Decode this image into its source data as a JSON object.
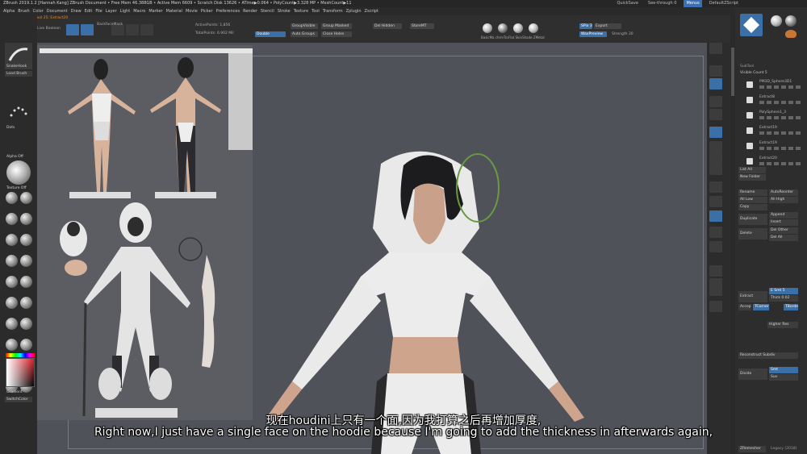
{
  "window": {
    "title": "ZBrush 2019.1.2 [Hannah Kang]   ZBrush Document   • Free Mem 46.388GB • Active Mem 6609 • Scratch Disk 13626 • ATime▶0.064 • PolyCount▶3.328 MP • MeshCount▶11",
    "quicksave": "QuickSave",
    "see_through": "See-through 0",
    "menus_label": "Menus",
    "default_zscript": "DefaultZScript"
  },
  "menu_items": [
    "Alpha",
    "Brush",
    "Color",
    "Document",
    "Draw",
    "Edit",
    "File",
    "Layer",
    "Light",
    "Macro",
    "Marker",
    "Material",
    "Movie",
    "Picker",
    "Preferences",
    "Render",
    "Stencil",
    "Stroke",
    "Texture",
    "Tool",
    "Transform",
    "Zplugin",
    "Zscript"
  ],
  "toolbar": {
    "lightbox": "LightBox",
    "live_boolean": "Live Boolean",
    "switching": "Switching to Subtool 25: Extract20",
    "edit": "Edit",
    "draw": "Draw",
    "move": "Move",
    "scale": "Scale",
    "rotate": "Rotate",
    "backface_mask": "BackfaceMask",
    "active_points": "ActivePoints: 1,856",
    "total_points": "TotalPoints: 6.902 Mil",
    "double": "Double",
    "group_visible": "GroupVisible",
    "group_masked": "Group Masked",
    "auto_groups": "Auto Groups",
    "close_holes": "Close Holes",
    "del_hidden": "Del Hidden",
    "store_mt": "StoreMT",
    "materials": [
      "BasicMa",
      "chrmTroFlat",
      "SkinShade",
      "ZMetal"
    ],
    "spix": "SPix 3",
    "export": "Export",
    "wax_preview": "WaxPreview",
    "strength": "Strength 30"
  },
  "left_tray": {
    "brush_name": "SnakeHook",
    "load_brush": "Load Brush",
    "stroke": "Dots",
    "alpha": "Alpha Off",
    "texture": "Texture Off",
    "brushes": [
      "Move",
      "Standard",
      "Move Topo",
      "ClayBuild",
      "ClayTubes",
      "Inflat",
      "Dam Std",
      "Magnify",
      "hPolish",
      "TrimDyn",
      "Pinch",
      "Move Inf",
      "MAHcut",
      "MAHcut",
      "SK_Slash",
      "Slash3",
      "SK_ArtBr",
      "SK_Pen",
      "PolyGr",
      "SK_Cloth"
    ],
    "gradient": "Gradient",
    "switch_color": "SwitchColor"
  },
  "right_shelf": [
    "SPix",
    "Scroll",
    "Zoom",
    "Actual",
    "AAHalf",
    "Persp",
    "Floor",
    "Local",
    "Frame",
    "Move",
    "Scale",
    "Rotate",
    "Line Fill",
    "PolyF",
    "Transp",
    "Ghost",
    "Solo",
    "Xpose"
  ],
  "subtools": {
    "header": "SubTool",
    "visible_count": "Visible Count 5",
    "items": [
      {
        "label": "PM3D_Sphere3D1"
      },
      {
        "label": "Extract8"
      },
      {
        "label": "PolySphere1_3"
      },
      {
        "label": "Extract19"
      },
      {
        "label": "Extract19"
      },
      {
        "label": "Extract20"
      }
    ],
    "list_all": "List All",
    "new_folder": "New Folder",
    "rename": "Rename",
    "autoreorder": "AutoReorder",
    "all_low": "All Low",
    "all_high": "All High",
    "copy": "Copy",
    "append": "Append",
    "duplicate": "Duplicate",
    "insert": "Insert",
    "delete": "Delete",
    "del_other": "Del Other",
    "del_all": "Del All",
    "extract": "Extract",
    "e_smt": "E Smt 5",
    "thick": "Thick 0.02",
    "accept": "Accept",
    "tcorner": "TCorner",
    "tborder": "TBorder",
    "higher_res": "Higher Res",
    "reconstruct": "Reconstruct Subdiv",
    "divide": "Divide",
    "smt": "Smt",
    "suv": "Suv",
    "zremesher": "ZRemesher",
    "legacy": "Legacy (2018)"
  },
  "subtitles": {
    "zh": "现在houdini上只有一个面,因为我打算之后再增加厚度,",
    "en": "Right now,I just have a single face on the hoodie because I'm going to add the thickness in afterwards again,"
  }
}
